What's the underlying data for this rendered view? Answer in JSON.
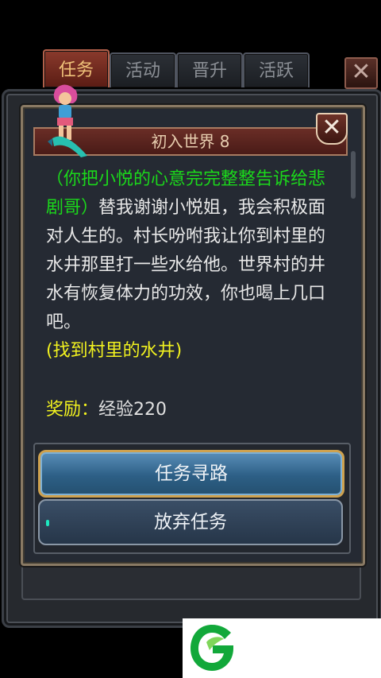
{
  "tabs": [
    {
      "label": "任务",
      "active": true
    },
    {
      "label": "活动",
      "active": false
    },
    {
      "label": "晋升",
      "active": false
    },
    {
      "label": "活跃",
      "active": false
    }
  ],
  "corner_close": "✕",
  "dialog": {
    "title": "初入世界 8",
    "close": "✕",
    "story_green": "（你把小悦的心意完完整整告诉给悲剧哥）",
    "story_white": "替我谢谢小悦姐，我会积极面对人生的。村长吩咐我让你到村里的水井那里打一些水给他。世界村的井水有恢复体力的功效，你也喝上几口吧。",
    "objective": "(找到村里的水井)",
    "reward_label": "奖励：",
    "reward_value": "经验220",
    "primary_button": "任务寻路",
    "secondary_button": "放弃任务"
  },
  "colors": {
    "green_text": "#1bd81b",
    "yellow_text": "#f2f21f",
    "active_tab": "#8a3a2c",
    "primary_button": "#3a72a0"
  },
  "icons": [
    "close-icon",
    "character-sprite",
    "game-logo"
  ]
}
